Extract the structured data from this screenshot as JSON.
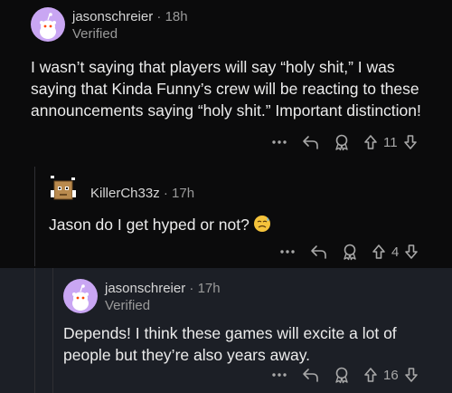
{
  "comments": [
    {
      "username": "jasonschreier",
      "separator": "·",
      "time": "18h",
      "flair": "Verified",
      "body": "I wasn’t saying that players will say “holy shit,” I was saying that Kinda Funny’s crew will be reacting to these announcements saying “holy shit.” Important distinction!",
      "score": "11",
      "avatar_icon": "snoo-avatar-icon"
    },
    {
      "username": "KillerCh33z",
      "separator": "·",
      "time": "17h",
      "body": "Jason do I get hyped or not?",
      "emoji": "worried-sweat-emoji",
      "score": "4",
      "avatar_icon": "cardboard-box-avatar-icon"
    },
    {
      "username": "jasonschreier",
      "separator": "·",
      "time": "17h",
      "flair": "Verified",
      "body": "Depends! I think these games will excite a lot of people but they’re also years away.",
      "score": "16",
      "avatar_icon": "snoo-avatar-icon"
    }
  ],
  "icons": {
    "more": "more-options-icon",
    "reply": "reply-icon",
    "award": "award-icon",
    "upvote": "upvote-icon",
    "downvote": "downvote-icon"
  },
  "colors": {
    "background": "#0b0b0c",
    "highlight": "#1c1f26",
    "avatar": "#c9a6f3",
    "text": "#ececec",
    "muted": "#9a9a9a"
  }
}
